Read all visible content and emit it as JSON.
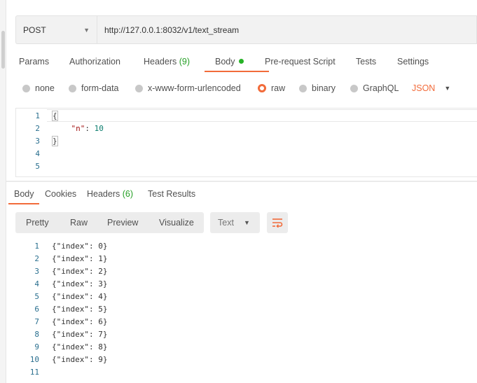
{
  "request": {
    "method": "POST",
    "url": "http://127.0.0.1:8032/v1/text_stream"
  },
  "request_tabs": {
    "params": "Params",
    "authorization": "Authorization",
    "headers": "Headers",
    "headers_count": "(9)",
    "body": "Body",
    "pre_request": "Pre-request Script",
    "tests": "Tests",
    "settings": "Settings",
    "active": "Body"
  },
  "body_types": {
    "none": "none",
    "form_data": "form-data",
    "urlencoded": "x-www-form-urlencoded",
    "raw": "raw",
    "binary": "binary",
    "graphql": "GraphQL",
    "selected": "raw",
    "language": "JSON"
  },
  "request_body": {
    "line_numbers": [
      "1",
      "2",
      "3",
      "4",
      "5"
    ],
    "open_brace": "{",
    "key": "\"n\"",
    "colon": ": ",
    "value": "10",
    "close_brace": "}"
  },
  "response_tabs": {
    "body": "Body",
    "cookies": "Cookies",
    "headers": "Headers",
    "headers_count": "(6)",
    "test_results": "Test Results",
    "active": "Body"
  },
  "response_toolbar": {
    "pretty": "Pretty",
    "raw": "Raw",
    "preview": "Preview",
    "visualize": "Visualize",
    "format": "Text",
    "wrap_icon": "wrap-lines-icon"
  },
  "response_body": {
    "lines": [
      {
        "n": "1",
        "text": "{\"index\": 0}"
      },
      {
        "n": "2",
        "text": "{\"index\": 1}"
      },
      {
        "n": "3",
        "text": "{\"index\": 2}"
      },
      {
        "n": "4",
        "text": "{\"index\": 3}"
      },
      {
        "n": "5",
        "text": "{\"index\": 4}"
      },
      {
        "n": "6",
        "text": "{\"index\": 5}"
      },
      {
        "n": "7",
        "text": "{\"index\": 6}"
      },
      {
        "n": "8",
        "text": "{\"index\": 7}"
      },
      {
        "n": "9",
        "text": "{\"index\": 8}"
      },
      {
        "n": "10",
        "text": "{\"index\": 9}"
      },
      {
        "n": "11",
        "text": ""
      }
    ]
  },
  "colors": {
    "accent": "#f26b3a",
    "count_green": "#26a026",
    "line_number": "#2a6f8f"
  }
}
